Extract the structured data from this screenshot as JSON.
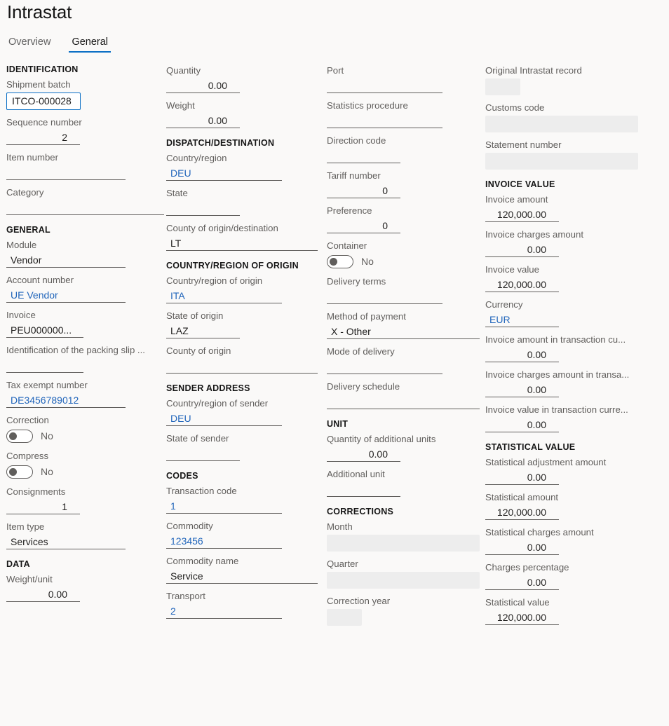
{
  "header": {
    "title": "Intrastat"
  },
  "tabs": [
    {
      "label": "Overview",
      "active": false
    },
    {
      "label": "General",
      "active": true
    }
  ],
  "colors": {
    "accent": "#0b6fc5",
    "link": "#2266bb",
    "label": "#605e5c",
    "text": "#201f1e",
    "background": "#faf9f8",
    "disabled": "#ededed"
  },
  "col1": {
    "section_identification": "IDENTIFICATION",
    "shipment_batch": {
      "label": "Shipment batch",
      "value": "ITCO-000028"
    },
    "sequence_number": {
      "label": "Sequence number",
      "value": "2"
    },
    "item_number": {
      "label": "Item number",
      "value": ""
    },
    "category": {
      "label": "Category",
      "value": ""
    },
    "section_general": "GENERAL",
    "module": {
      "label": "Module",
      "value": "Vendor"
    },
    "account_number": {
      "label": "Account number",
      "value": "UE Vendor"
    },
    "invoice": {
      "label": "Invoice",
      "value": "PEU000000..."
    },
    "packing_slip": {
      "label": "Identification of the packing slip ...",
      "value": ""
    },
    "tax_exempt_number": {
      "label": "Tax exempt number",
      "value": "DE3456789012"
    },
    "correction": {
      "label": "Correction",
      "value": "No"
    },
    "compress": {
      "label": "Compress",
      "value": "No"
    },
    "consignments": {
      "label": "Consignments",
      "value": "1"
    },
    "item_type": {
      "label": "Item type",
      "value": "Services"
    },
    "section_data": "DATA",
    "weight_unit": {
      "label": "Weight/unit",
      "value": "0.00"
    }
  },
  "col2": {
    "quantity": {
      "label": "Quantity",
      "value": "0.00"
    },
    "weight": {
      "label": "Weight",
      "value": "0.00"
    },
    "section_dispatch": "DISPATCH/DESTINATION",
    "country_region": {
      "label": "Country/region",
      "value": "DEU"
    },
    "state": {
      "label": "State",
      "value": ""
    },
    "county_origin_destination": {
      "label": "County of origin/destination",
      "value": "LT"
    },
    "section_country_origin": "COUNTRY/REGION OF ORIGIN",
    "country_region_origin": {
      "label": "Country/region of origin",
      "value": "ITA"
    },
    "state_of_origin": {
      "label": "State of origin",
      "value": "LAZ"
    },
    "county_of_origin": {
      "label": "County of origin",
      "value": ""
    },
    "section_sender_address": "SENDER ADDRESS",
    "country_region_sender": {
      "label": "Country/region of sender",
      "value": "DEU"
    },
    "state_of_sender": {
      "label": "State of sender",
      "value": ""
    },
    "section_codes": "CODES",
    "transaction_code": {
      "label": "Transaction code",
      "value": "1"
    },
    "commodity": {
      "label": "Commodity",
      "value": "123456"
    },
    "commodity_name": {
      "label": "Commodity name",
      "value": "Service"
    },
    "transport": {
      "label": "Transport",
      "value": "2"
    }
  },
  "col3": {
    "port": {
      "label": "Port",
      "value": ""
    },
    "statistics_procedure": {
      "label": "Statistics procedure",
      "value": ""
    },
    "direction_code": {
      "label": "Direction code",
      "value": ""
    },
    "tariff_number": {
      "label": "Tariff number",
      "value": "0"
    },
    "preference": {
      "label": "Preference",
      "value": "0"
    },
    "container": {
      "label": "Container",
      "value": "No"
    },
    "delivery_terms": {
      "label": "Delivery terms",
      "value": ""
    },
    "method_of_payment": {
      "label": "Method of payment",
      "value": "X - Other"
    },
    "mode_of_delivery": {
      "label": "Mode of delivery",
      "value": ""
    },
    "delivery_schedule": {
      "label": "Delivery schedule",
      "value": ""
    },
    "section_unit": "UNIT",
    "quantity_additional_units": {
      "label": "Quantity of additional units",
      "value": "0.00"
    },
    "additional_unit": {
      "label": "Additional unit",
      "value": ""
    },
    "section_corrections": "CORRECTIONS",
    "month": {
      "label": "Month",
      "value": ""
    },
    "quarter": {
      "label": "Quarter",
      "value": ""
    },
    "correction_year": {
      "label": "Correction year",
      "value": ""
    }
  },
  "col4": {
    "original_intrastat_record": {
      "label": "Original Intrastat record",
      "value": ""
    },
    "customs_code": {
      "label": "Customs code",
      "value": ""
    },
    "statement_number": {
      "label": "Statement number",
      "value": ""
    },
    "section_invoice_value": "INVOICE VALUE",
    "invoice_amount": {
      "label": "Invoice amount",
      "value": "120,000.00"
    },
    "invoice_charges_amount": {
      "label": "Invoice charges amount",
      "value": "0.00"
    },
    "invoice_value": {
      "label": "Invoice value",
      "value": "120,000.00"
    },
    "currency": {
      "label": "Currency",
      "value": "EUR"
    },
    "invoice_amount_transaction": {
      "label": "Invoice amount in transaction cu...",
      "value": "0.00"
    },
    "invoice_charges_transaction": {
      "label": "Invoice charges amount in transa...",
      "value": "0.00"
    },
    "invoice_value_transaction": {
      "label": "Invoice value in transaction curre...",
      "value": "0.00"
    },
    "section_statistical_value": "STATISTICAL VALUE",
    "statistical_adjustment_amount": {
      "label": "Statistical adjustment amount",
      "value": "0.00"
    },
    "statistical_amount": {
      "label": "Statistical amount",
      "value": "120,000.00"
    },
    "statistical_charges_amount": {
      "label": "Statistical charges amount",
      "value": "0.00"
    },
    "charges_percentage": {
      "label": "Charges percentage",
      "value": "0.00"
    },
    "statistical_value": {
      "label": "Statistical value",
      "value": "120,000.00"
    }
  }
}
